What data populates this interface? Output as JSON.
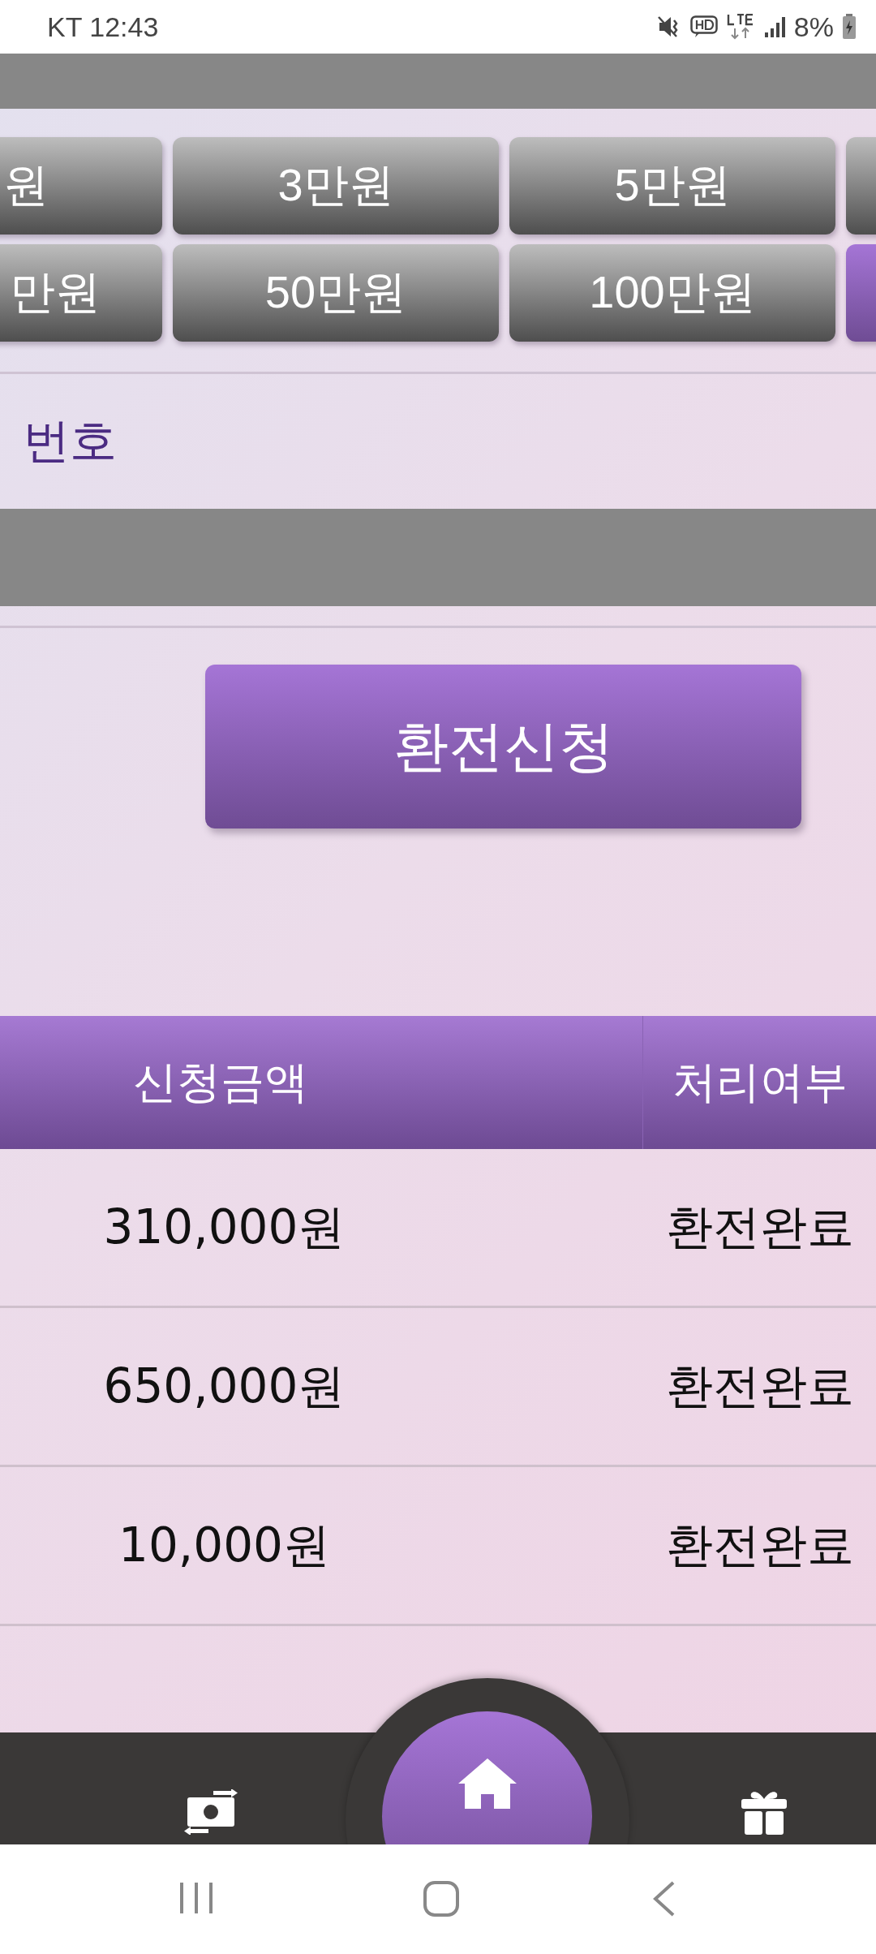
{
  "status_bar": {
    "carrier_time": "KT 12:43",
    "battery": "8%"
  },
  "amount_rows": [
    [
      {
        "label": "원",
        "selected": false
      },
      {
        "label": "3만원",
        "selected": false
      },
      {
        "label": "5만원",
        "selected": false
      },
      {
        "selected": false
      }
    ],
    [
      {
        "label": "만원",
        "selected": false
      },
      {
        "label": "50만원",
        "selected": false
      },
      {
        "label": "100만원",
        "selected": false
      },
      {
        "selected": true
      }
    ]
  ],
  "field_label": "번호",
  "submit_button": "환전신청",
  "table": {
    "columns": [
      "신청금액",
      "처리여부"
    ],
    "rows": [
      {
        "amount": "310,000원",
        "status": "환전완료"
      },
      {
        "amount": "650,000원",
        "status": "환전완료"
      },
      {
        "amount": "10,000원",
        "status": "환전완료"
      }
    ]
  },
  "bottom_nav": [
    {
      "kind": "exchange"
    },
    {
      "kind": "home"
    },
    {
      "kind": "gift"
    }
  ]
}
